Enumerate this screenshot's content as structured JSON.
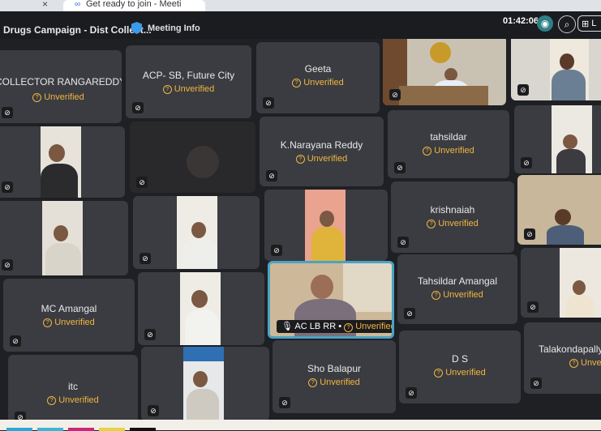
{
  "browser": {
    "tab_close": "×",
    "tab_title": "Get ready to join - Meeti"
  },
  "topbar": {
    "meeting_title": "Drugs Campaign - Dist Collect...",
    "meeting_info": "Meeting Info",
    "timer": "01:42:06",
    "layout_label": "L"
  },
  "unverified_label": "Unverified",
  "tiles": [
    {
      "name": "COLLECTOR RANGAREDDY"
    },
    {
      "name": "ACP- SB, Future City"
    },
    {
      "name": "Geeta"
    },
    {
      "name": "K.Narayana Reddy"
    },
    {
      "name": "tahsildar"
    },
    {
      "name": "krishnaiah"
    },
    {
      "name": "MC Amangal"
    },
    {
      "name": "Tahsildar  Amangal"
    },
    {
      "name": "itc"
    },
    {
      "name": "Sho Balapur"
    },
    {
      "name": "D S"
    },
    {
      "name": "Talakondapally T"
    }
  ],
  "speaker": {
    "name": "AC LB RR",
    "separator": "•"
  }
}
